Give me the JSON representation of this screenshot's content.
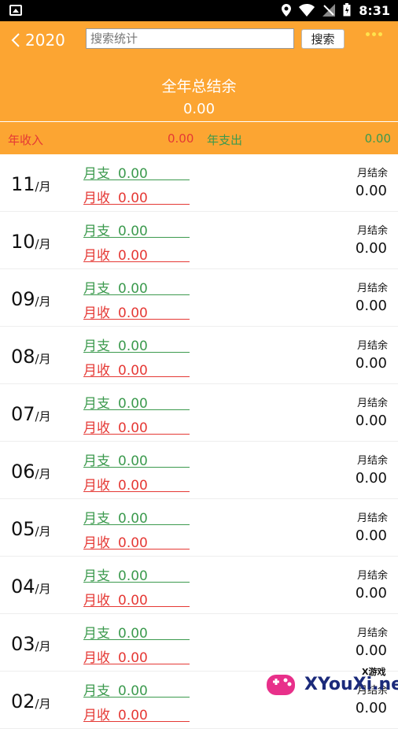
{
  "status_bar": {
    "time": "8:31"
  },
  "header": {
    "back_label": "2020",
    "search_placeholder": "搜索统计",
    "search_button": "搜索",
    "summary_title": "全年总结余",
    "summary_value": "0.00",
    "year_income_label": "年收入",
    "year_income_value": "0.00",
    "year_expense_label": "年支出",
    "year_expense_value": "0.00"
  },
  "colors": {
    "header_bg": "#FCA532",
    "income": "#E53935",
    "expense": "#3C9A4E"
  },
  "labels": {
    "month_unit": "/月",
    "expense": "月支",
    "income": "月收",
    "balance": "月结余"
  },
  "months": [
    {
      "month": "11",
      "expense": "0.00",
      "income": "0.00",
      "balance": "0.00"
    },
    {
      "month": "10",
      "expense": "0.00",
      "income": "0.00",
      "balance": "0.00"
    },
    {
      "month": "09",
      "expense": "0.00",
      "income": "0.00",
      "balance": "0.00"
    },
    {
      "month": "08",
      "expense": "0.00",
      "income": "0.00",
      "balance": "0.00"
    },
    {
      "month": "07",
      "expense": "0.00",
      "income": "0.00",
      "balance": "0.00"
    },
    {
      "month": "06",
      "expense": "0.00",
      "income": "0.00",
      "balance": "0.00"
    },
    {
      "month": "05",
      "expense": "0.00",
      "income": "0.00",
      "balance": "0.00"
    },
    {
      "month": "04",
      "expense": "0.00",
      "income": "0.00",
      "balance": "0.00"
    },
    {
      "month": "03",
      "expense": "0.00",
      "income": "0.00",
      "balance": "0.00"
    },
    {
      "month": "02",
      "expense": "0.00",
      "income": "0.00",
      "balance": "0.00"
    }
  ],
  "watermark": {
    "small": "X游戏",
    "text": "XYouXi.net"
  }
}
